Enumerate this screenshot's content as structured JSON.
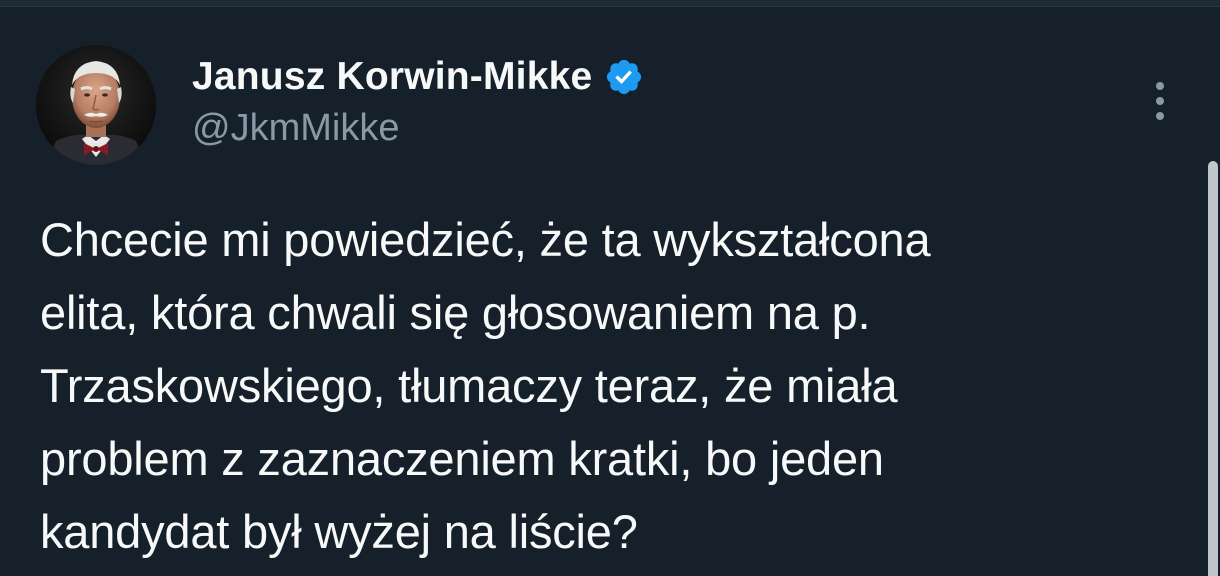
{
  "tweet": {
    "author": {
      "display_name": "Janusz Korwin-Mikke",
      "handle": "@JkmMikke",
      "verified": true,
      "avatar_icon": "avatar-photo"
    },
    "text": "Chcecie mi powiedzieć, że ta wykształcona\nelita, która chwali się głosowaniem na p.\nTrzaskowskiego, tłumaczy teraz, że miała\nproblem z zaznaczeniem kratki, bo jeden\nkandydat był wyżej na liście?",
    "more_icon": "more-vertical-icon"
  },
  "colors": {
    "background": "#15202b",
    "text": "#f7f9f9",
    "secondary_text": "#8b98a5",
    "verified": "#1d9bf0"
  }
}
